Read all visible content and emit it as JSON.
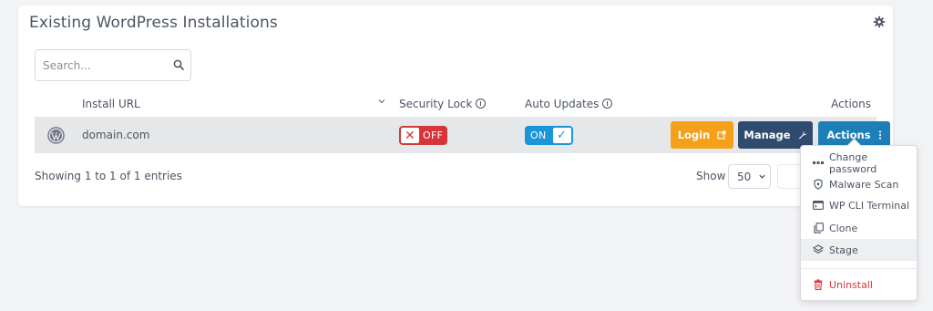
{
  "card": {
    "title": "Existing WordPress Installations",
    "settings_icon": "gear-icon"
  },
  "search": {
    "placeholder": "Search...",
    "value": "",
    "icon": "search-icon"
  },
  "table": {
    "columns": {
      "install_url": "Install URL",
      "security_lock": "Security Lock",
      "auto_updates": "Auto Updates",
      "actions": "Actions"
    },
    "rows": [
      {
        "icon": "wordpress-logo-icon",
        "domain": "domain.com",
        "security_lock": {
          "state": "OFF",
          "icon": "x-icon"
        },
        "auto_updates": {
          "state": "ON",
          "icon": "check-icon"
        },
        "buttons": {
          "login": "Login",
          "manage": "Manage",
          "actions": "Actions"
        }
      }
    ]
  },
  "footer": {
    "entries_text": "Showing 1 to 1 of 1 entries",
    "show_label": "Show",
    "page_size": "50"
  },
  "actions_menu": {
    "items": [
      {
        "label": "Change password",
        "icon": "dots-icon"
      },
      {
        "label": "Malware Scan",
        "icon": "shield-icon"
      },
      {
        "label": "WP CLI Terminal",
        "icon": "terminal-icon"
      },
      {
        "label": "Clone",
        "icon": "copy-icon"
      },
      {
        "label": "Stage",
        "icon": "layers-icon"
      },
      {
        "label": "Uninstall",
        "icon": "trash-icon"
      }
    ]
  },
  "colors": {
    "login": "#f5a01a",
    "manage": "#2f4b6e",
    "actions": "#1c7fb8",
    "toggle_off": "#d9343a",
    "toggle_on": "#1a95d8"
  }
}
